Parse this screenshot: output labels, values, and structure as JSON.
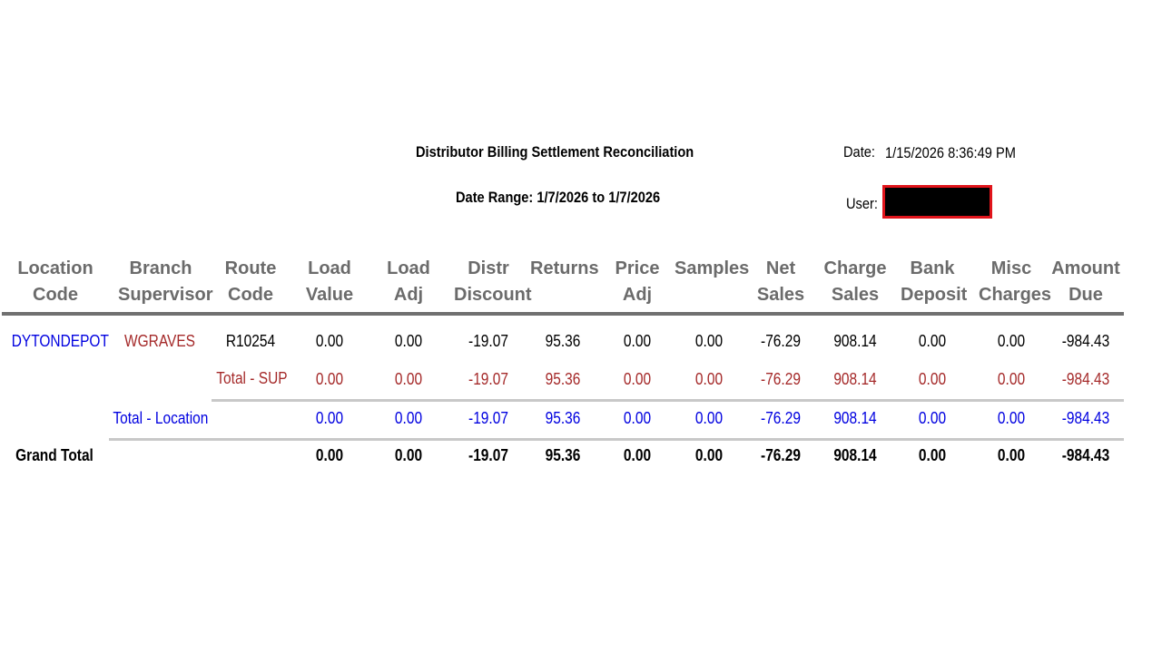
{
  "report": {
    "title": "Distributor Billing Settlement Reconciliation",
    "date_range": "Date Range: 1/7/2026 to 1/7/2026",
    "date_label": "Date:",
    "date_value": "1/15/2026 8:36:49 PM",
    "user_label": "User:",
    "user_value_redacted": true
  },
  "columns": [
    [
      "Location",
      "Code"
    ],
    [
      "Branch",
      "Supervisor"
    ],
    [
      "Route",
      "Code"
    ],
    [
      "Load",
      "Value"
    ],
    [
      "Load",
      "Adj"
    ],
    [
      "Distr",
      "Discount"
    ],
    [
      "Returns",
      ""
    ],
    [
      "Price",
      "Adj"
    ],
    [
      "Samples",
      ""
    ],
    [
      "Net",
      "Sales"
    ],
    [
      "Charge",
      "Sales"
    ],
    [
      "Bank",
      "Deposit"
    ],
    [
      "Misc",
      "Charges"
    ],
    [
      "Amount",
      "Due"
    ]
  ],
  "rows": [
    {
      "type": "detail",
      "location": "DYTONDEPOT",
      "supervisor": "WGRAVES",
      "route": "R10254",
      "values": [
        "0.00",
        "0.00",
        "-19.07",
        "95.36",
        "0.00",
        "0.00",
        "-76.29",
        "908.14",
        "0.00",
        "0.00",
        "-984.43"
      ]
    },
    {
      "type": "total_sup",
      "label": "Total - SUP",
      "values": [
        "0.00",
        "0.00",
        "-19.07",
        "95.36",
        "0.00",
        "0.00",
        "-76.29",
        "908.14",
        "0.00",
        "0.00",
        "-984.43"
      ]
    },
    {
      "type": "total_location",
      "label": "Total - Location",
      "values": [
        "0.00",
        "0.00",
        "-19.07",
        "95.36",
        "0.00",
        "0.00",
        "-76.29",
        "908.14",
        "0.00",
        "0.00",
        "-984.43"
      ]
    },
    {
      "type": "grand_total",
      "label": "Grand Total",
      "values": [
        "0.00",
        "0.00",
        "-19.07",
        "95.36",
        "0.00",
        "0.00",
        "-76.29",
        "908.14",
        "0.00",
        "0.00",
        "-984.43"
      ]
    }
  ],
  "colors": {
    "location_blue": "#0000e0",
    "supervisor_red": "#a52a2a",
    "header_gray": "#6b6b6b",
    "redaction_border": "#e0141b"
  }
}
